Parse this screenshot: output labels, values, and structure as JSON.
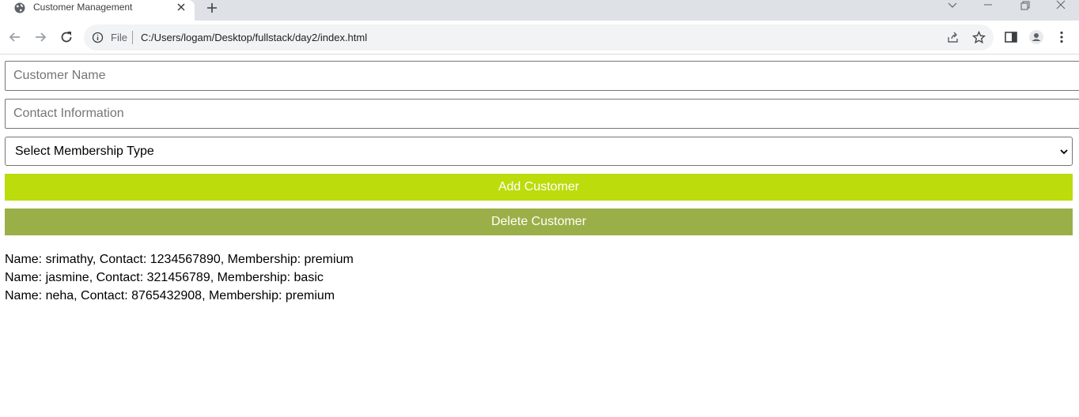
{
  "browser": {
    "tab_title": "Customer Management",
    "scheme_label": "File",
    "url": "C:/Users/logam/Desktop/fullstack/day2/index.html"
  },
  "form": {
    "name_placeholder": "Customer Name",
    "name_value": "",
    "contact_placeholder": "Contact Information",
    "contact_value": "",
    "membership_selected": "Select Membership Type",
    "add_label": "Add Customer",
    "delete_label": "Delete Customer"
  },
  "colors": {
    "add_button": "#bcdc0b",
    "delete_button": "#9aaf47"
  },
  "customers": [
    "Name: srimathy, Contact: 1234567890, Membership: premium",
    "Name: jasmine, Contact: 321456789, Membership: basic",
    "Name: neha, Contact: 8765432908, Membership: premium"
  ]
}
